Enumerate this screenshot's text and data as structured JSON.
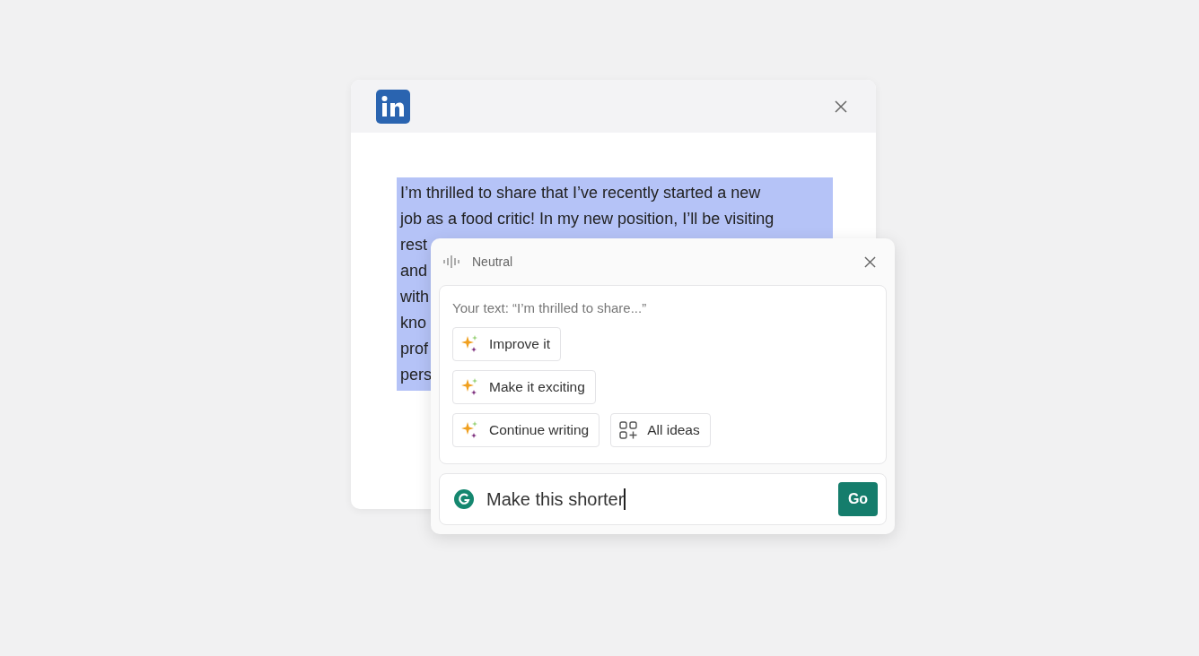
{
  "post": {
    "highlighted": true,
    "lines": [
      "I’m thrilled to share that I’ve recently started a new",
      "job as a food critic! In my new position, I’ll be visiting",
      "rest",
      "and",
      "with",
      "kno",
      "prof",
      "pers"
    ]
  },
  "assistant": {
    "tone": "Neutral",
    "context": "Your text: “I’m thrilled to share...”",
    "suggestions": [
      {
        "kind": "sparkle",
        "label": "Improve it"
      },
      {
        "kind": "sparkle",
        "label": "Make it exciting"
      },
      {
        "kind": "sparkle",
        "label": "Continue writing"
      },
      {
        "kind": "ideas",
        "label": "All ideas"
      }
    ],
    "prompt": {
      "value": "Make this shorter",
      "focused": true
    },
    "submit": "Go"
  }
}
